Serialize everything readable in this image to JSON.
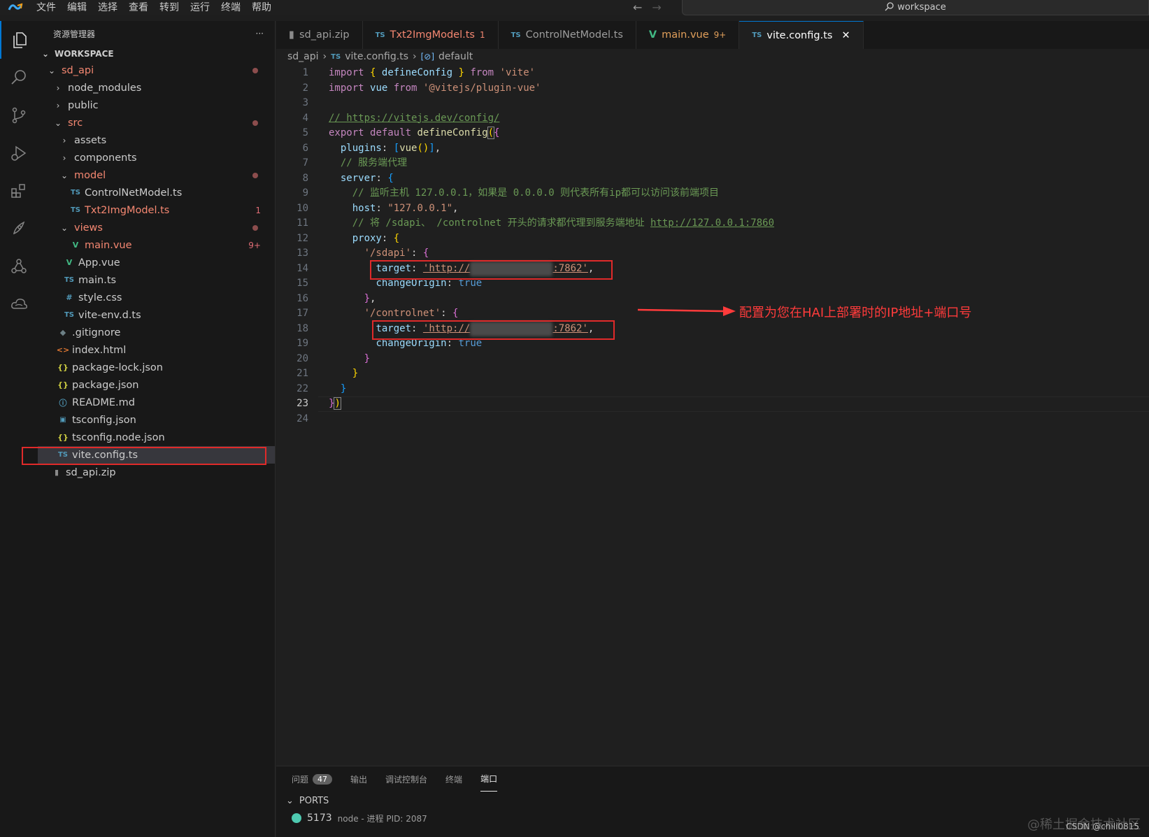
{
  "titlebar": {
    "menu": [
      "文件",
      "编辑",
      "选择",
      "查看",
      "转到",
      "运行",
      "终端",
      "帮助"
    ],
    "search_text": "workspace"
  },
  "sidebar": {
    "title": "资源管理器",
    "more": "···",
    "section": "WORKSPACE",
    "items": [
      {
        "label": "sd_api",
        "depth": 0,
        "type": "folder-open",
        "modified": true,
        "dot": true
      },
      {
        "label": "node_modules",
        "depth": 1,
        "type": "folder"
      },
      {
        "label": "public",
        "depth": 1,
        "type": "folder"
      },
      {
        "label": "src",
        "depth": 1,
        "type": "folder-open",
        "modified": true,
        "dot": true
      },
      {
        "label": "assets",
        "depth": 2,
        "type": "folder"
      },
      {
        "label": "components",
        "depth": 2,
        "type": "folder"
      },
      {
        "label": "model",
        "depth": 2,
        "type": "folder-open",
        "modified": true,
        "dot": true
      },
      {
        "label": "ControlNetModel.ts",
        "depth": 3,
        "type": "ts"
      },
      {
        "label": "Txt2ImgModel.ts",
        "depth": 3,
        "type": "ts",
        "modified": true,
        "badge": "1"
      },
      {
        "label": "views",
        "depth": 2,
        "type": "folder-open",
        "modified": true,
        "dot": true
      },
      {
        "label": "main.vue",
        "depth": 3,
        "type": "vue",
        "modified": true,
        "badge": "9+"
      },
      {
        "label": "App.vue",
        "depth": 2,
        "type": "vue"
      },
      {
        "label": "main.ts",
        "depth": 2,
        "type": "ts"
      },
      {
        "label": "style.css",
        "depth": 2,
        "type": "css"
      },
      {
        "label": "vite-env.d.ts",
        "depth": 2,
        "type": "ts"
      },
      {
        "label": ".gitignore",
        "depth": 1,
        "type": "git"
      },
      {
        "label": "index.html",
        "depth": 1,
        "type": "html"
      },
      {
        "label": "package-lock.json",
        "depth": 1,
        "type": "json"
      },
      {
        "label": "package.json",
        "depth": 1,
        "type": "json"
      },
      {
        "label": "README.md",
        "depth": 1,
        "type": "info"
      },
      {
        "label": "tsconfig.json",
        "depth": 1,
        "type": "tsconfig"
      },
      {
        "label": "tsconfig.node.json",
        "depth": 1,
        "type": "json"
      },
      {
        "label": "vite.config.ts",
        "depth": 1,
        "type": "ts",
        "selected": true
      },
      {
        "label": "sd_api.zip",
        "depth": 0,
        "type": "zip"
      }
    ]
  },
  "tabs": [
    {
      "label": "sd_api.zip",
      "icon": "zip"
    },
    {
      "label": "Txt2ImgModel.ts",
      "icon": "TS",
      "count": "1",
      "state": "error"
    },
    {
      "label": "ControlNetModel.ts",
      "icon": "TS"
    },
    {
      "label": "main.vue",
      "icon": "vue",
      "count": "9+",
      "state": "modified"
    },
    {
      "label": "vite.config.ts",
      "icon": "TS",
      "active": true,
      "close": "✕"
    }
  ],
  "breadcrumb": [
    "sd_api",
    "vite.config.ts",
    "default"
  ],
  "code": {
    "l9_comment": "// 监听主机 127.0.0.1，如果是 0.0.0.0 则代表所有ip都可以访问该前端项目",
    "l11_comment": "// 将 /sdapi、 /controlnet 开头的请求都代理到服务端地址 ",
    "l11_link": "http://127.0.0.1:7860",
    "l4_link": "// https://vitejs.dev/config/",
    "l7_comment": "// 服务端代理",
    "host": "\"127.0.0.1\"",
    "target_prefix": "'http://",
    "target_suffix": ":7862'",
    "sdapi_key": "'/sdapi'",
    "controlnet_key": "'/controlnet'",
    "vite": "'vite'",
    "plugin": "'@vitejs/plugin-vue'",
    "true": "true"
  },
  "annotation": "配置为您在HAI上部署时的IP地址+端口号",
  "panel": {
    "tabs": [
      "问题",
      "输出",
      "调试控制台",
      "终端",
      "端口"
    ],
    "problem_count": "47",
    "ports_header": "PORTS",
    "port": "5173",
    "port_desc": "node - 进程 PID: 2087"
  },
  "watermark": "@稀土掘金技术社区",
  "watermark2": "CSDN @chili0815"
}
